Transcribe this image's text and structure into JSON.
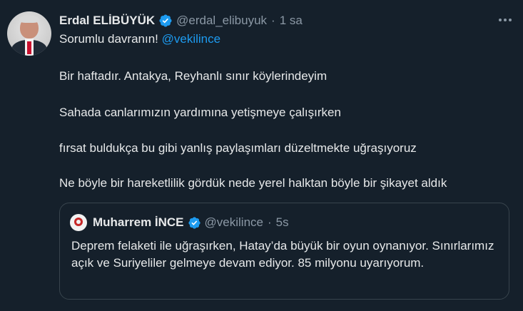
{
  "tweet": {
    "author_name": "Erdal ELİBÜYÜK",
    "author_handle": "@erdal_elibuyuk",
    "separator": "·",
    "time": "1 sa",
    "line1_text": "Sorumlu davranın! ",
    "line1_mention": "@vekilince",
    "line2": "Bir haftadır. Antakya, Reyhanlı sınır köylerindeyim",
    "line3": "Sahada canlarımızın yardımına yetişmeye çalışırken",
    "line4": "fırsat buldukça bu gibi yanlış paylaşımları düzeltmekte uğraşıyoruz",
    "line5": "Ne böyle bir hareketlilik gördük nede yerel halktan böyle bir şikayet aldık"
  },
  "quote": {
    "author_name": "Muharrem İNCE",
    "author_handle": "@vekilince",
    "separator": "·",
    "time": "5s",
    "text": "Deprem felaketi ile uğraşırken, Hatay’da büyük bir oyun oynanıyor. Sınırlarımız açık ve Suriyeliler gelmeye devam ediyor. 85 milyonu uyarıyorum."
  },
  "icons": {
    "verified": "verified-badge-icon",
    "more": "more-options-icon"
  },
  "colors": {
    "background": "#15202b",
    "text": "#e7e9ea",
    "secondary_text": "#8b98a5",
    "accent": "#1d9bf0",
    "border": "#38444d"
  }
}
